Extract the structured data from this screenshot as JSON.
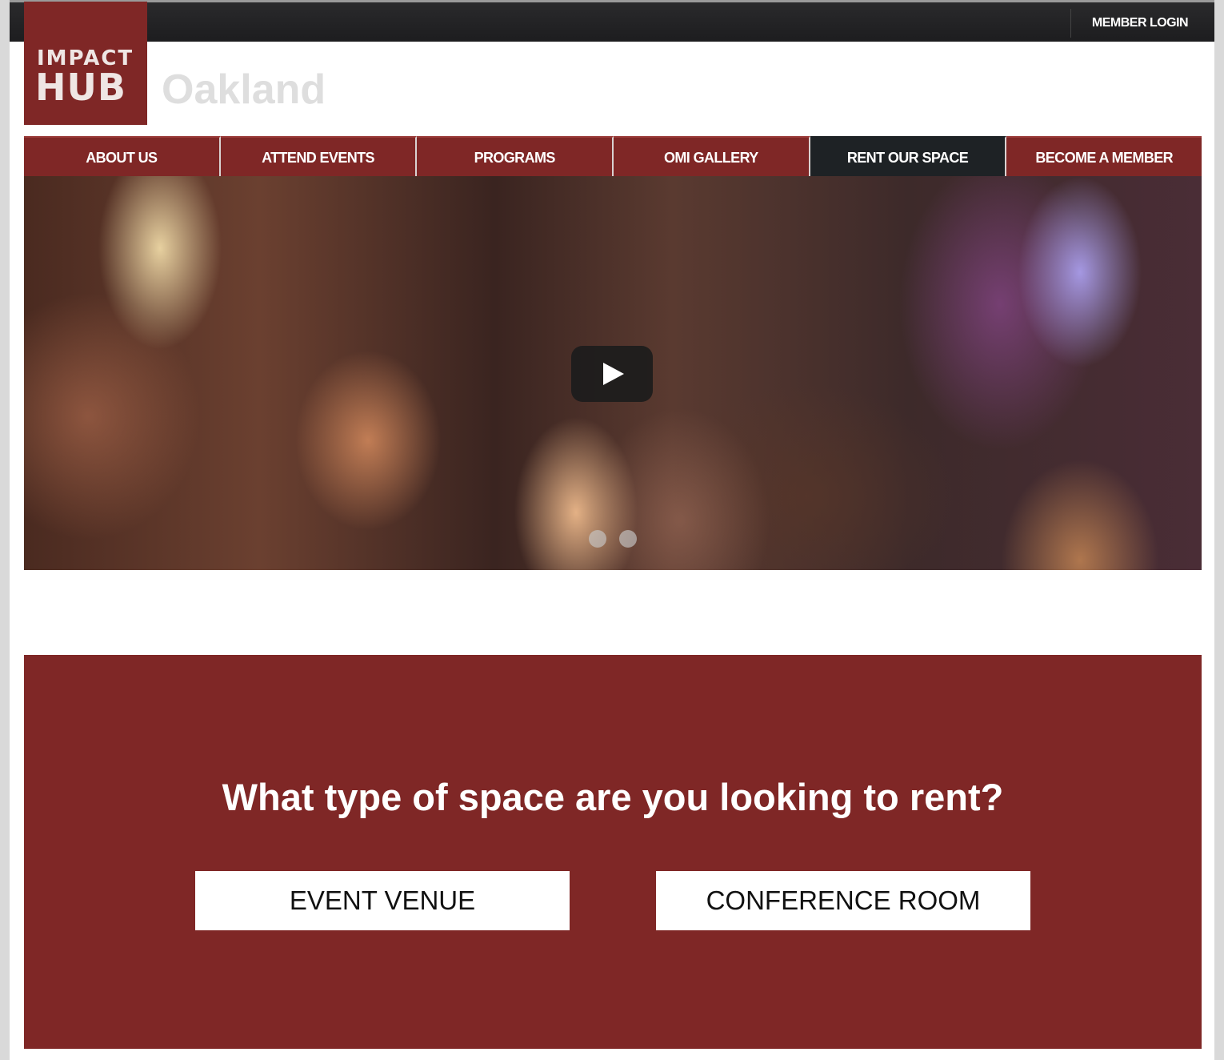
{
  "header": {
    "member_login": "MEMBER LOGIN",
    "logo_line1": "IMPACT",
    "logo_line2": "HUB",
    "city": "Oakland"
  },
  "nav": {
    "items": [
      {
        "label": "ABOUT US"
      },
      {
        "label": "ATTEND EVENTS"
      },
      {
        "label": "PROGRAMS"
      },
      {
        "label": "OMI GALLERY"
      },
      {
        "label": "RENT OUR SPACE",
        "active": true
      },
      {
        "label": "BECOME A MEMBER"
      }
    ]
  },
  "hero": {
    "play_icon": "play-icon",
    "slides": 2
  },
  "cta": {
    "question": "What type of space are you looking to rent?",
    "option1": "EVENT VENUE",
    "option2": "CONFERENCE ROOM"
  },
  "colors": {
    "brand": "#7f2726",
    "active_nav": "#1e2225",
    "topbar": "#2a2a2c"
  }
}
